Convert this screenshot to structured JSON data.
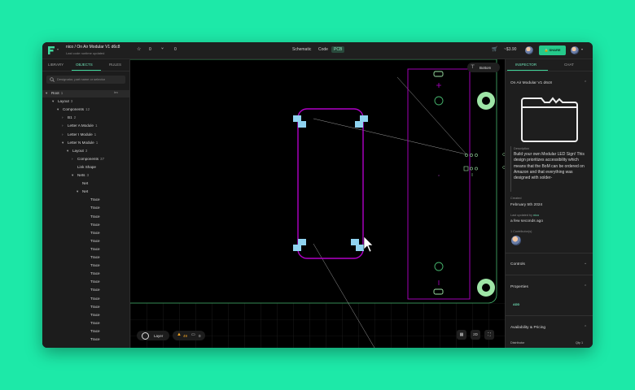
{
  "topbar": {
    "title": "nico / On Air Modular V1 d6c8",
    "subtitle": "Last code runtime updated",
    "stars": "0",
    "forks": "0",
    "view_schematic": "Schematic",
    "view_code": "Code",
    "view_pcb": "PCB",
    "price": "~$3.90",
    "share_label": "SHARE"
  },
  "left_panel": {
    "tabs": [
      "LIBRARY",
      "OBJECTS",
      "RULES"
    ],
    "active_tab": "OBJECTS",
    "search_placeholder": "Designator, part name or selector",
    "tree": [
      {
        "label": "Root",
        "count": "1",
        "badge": "len"
      },
      {
        "label": "Layout",
        "count": "3"
      },
      {
        "label": "Components",
        "count": "12"
      },
      {
        "label": "B1",
        "count": "2"
      },
      {
        "label": "Letter A Module",
        "count": "1"
      },
      {
        "label": "Letter I Module",
        "count": "1"
      },
      {
        "label": "Letter N Module",
        "count": "1"
      },
      {
        "label": "Layout",
        "count": "3"
      },
      {
        "label": "Components",
        "count": "37"
      },
      {
        "label": "Link Shape",
        "count": ""
      },
      {
        "label": "Nets",
        "count": "3"
      },
      {
        "label": "Net",
        "count": ""
      },
      {
        "label": "Net",
        "count": ""
      },
      {
        "label": "Trace",
        "count": ""
      },
      {
        "label": "Trace",
        "count": ""
      },
      {
        "label": "Trace",
        "count": ""
      },
      {
        "label": "Trace",
        "count": ""
      },
      {
        "label": "Trace",
        "count": ""
      },
      {
        "label": "Trace",
        "count": ""
      },
      {
        "label": "Trace",
        "count": ""
      },
      {
        "label": "Trace",
        "count": ""
      },
      {
        "label": "Trace",
        "count": ""
      },
      {
        "label": "Trace",
        "count": ""
      },
      {
        "label": "Trace",
        "count": ""
      },
      {
        "label": "Trace",
        "count": ""
      },
      {
        "label": "Trace",
        "count": ""
      },
      {
        "label": "Trace",
        "count": ""
      },
      {
        "label": "Trace",
        "count": ""
      },
      {
        "label": "Trace",
        "count": ""
      },
      {
        "label": "Trace",
        "count": ""
      },
      {
        "label": "Trace",
        "count": ""
      }
    ]
  },
  "canvas": {
    "layer_toggle": "Bottom",
    "layer_button": "Layer",
    "warnings": "49",
    "comments": "0",
    "view_2d": "2D"
  },
  "right_panel": {
    "tabs": [
      "INSPECTOR",
      "CHAT"
    ],
    "active_tab": "INSPECTOR",
    "project_name": "On Air Modular V1 d6c8",
    "description_label": "Description",
    "description": "Build your own Modular LED Sign! This design prioritizes accessibility which means that the BoM can be ordered on Amazon and that everything was designed with solder-",
    "created_label": "Created",
    "created_value": "February 5th 2024",
    "updated_label": "Last updated by",
    "updated_by": "nico",
    "updated_value": "a few seconds ago",
    "contributors_label": "1 Contributor(s)",
    "controls": "Controls",
    "properties": "Properties",
    "add_label": "ADD",
    "availability": "Availability & Pricing",
    "distributor_label": "Distributor",
    "quantity_label": "Qty 1"
  },
  "colors": {
    "background": "#1de9a8",
    "accent": "#25c98a",
    "board_outline": "#b100c8",
    "pad": "#8fd3f0",
    "ground_pad": "#9ee5a6"
  }
}
